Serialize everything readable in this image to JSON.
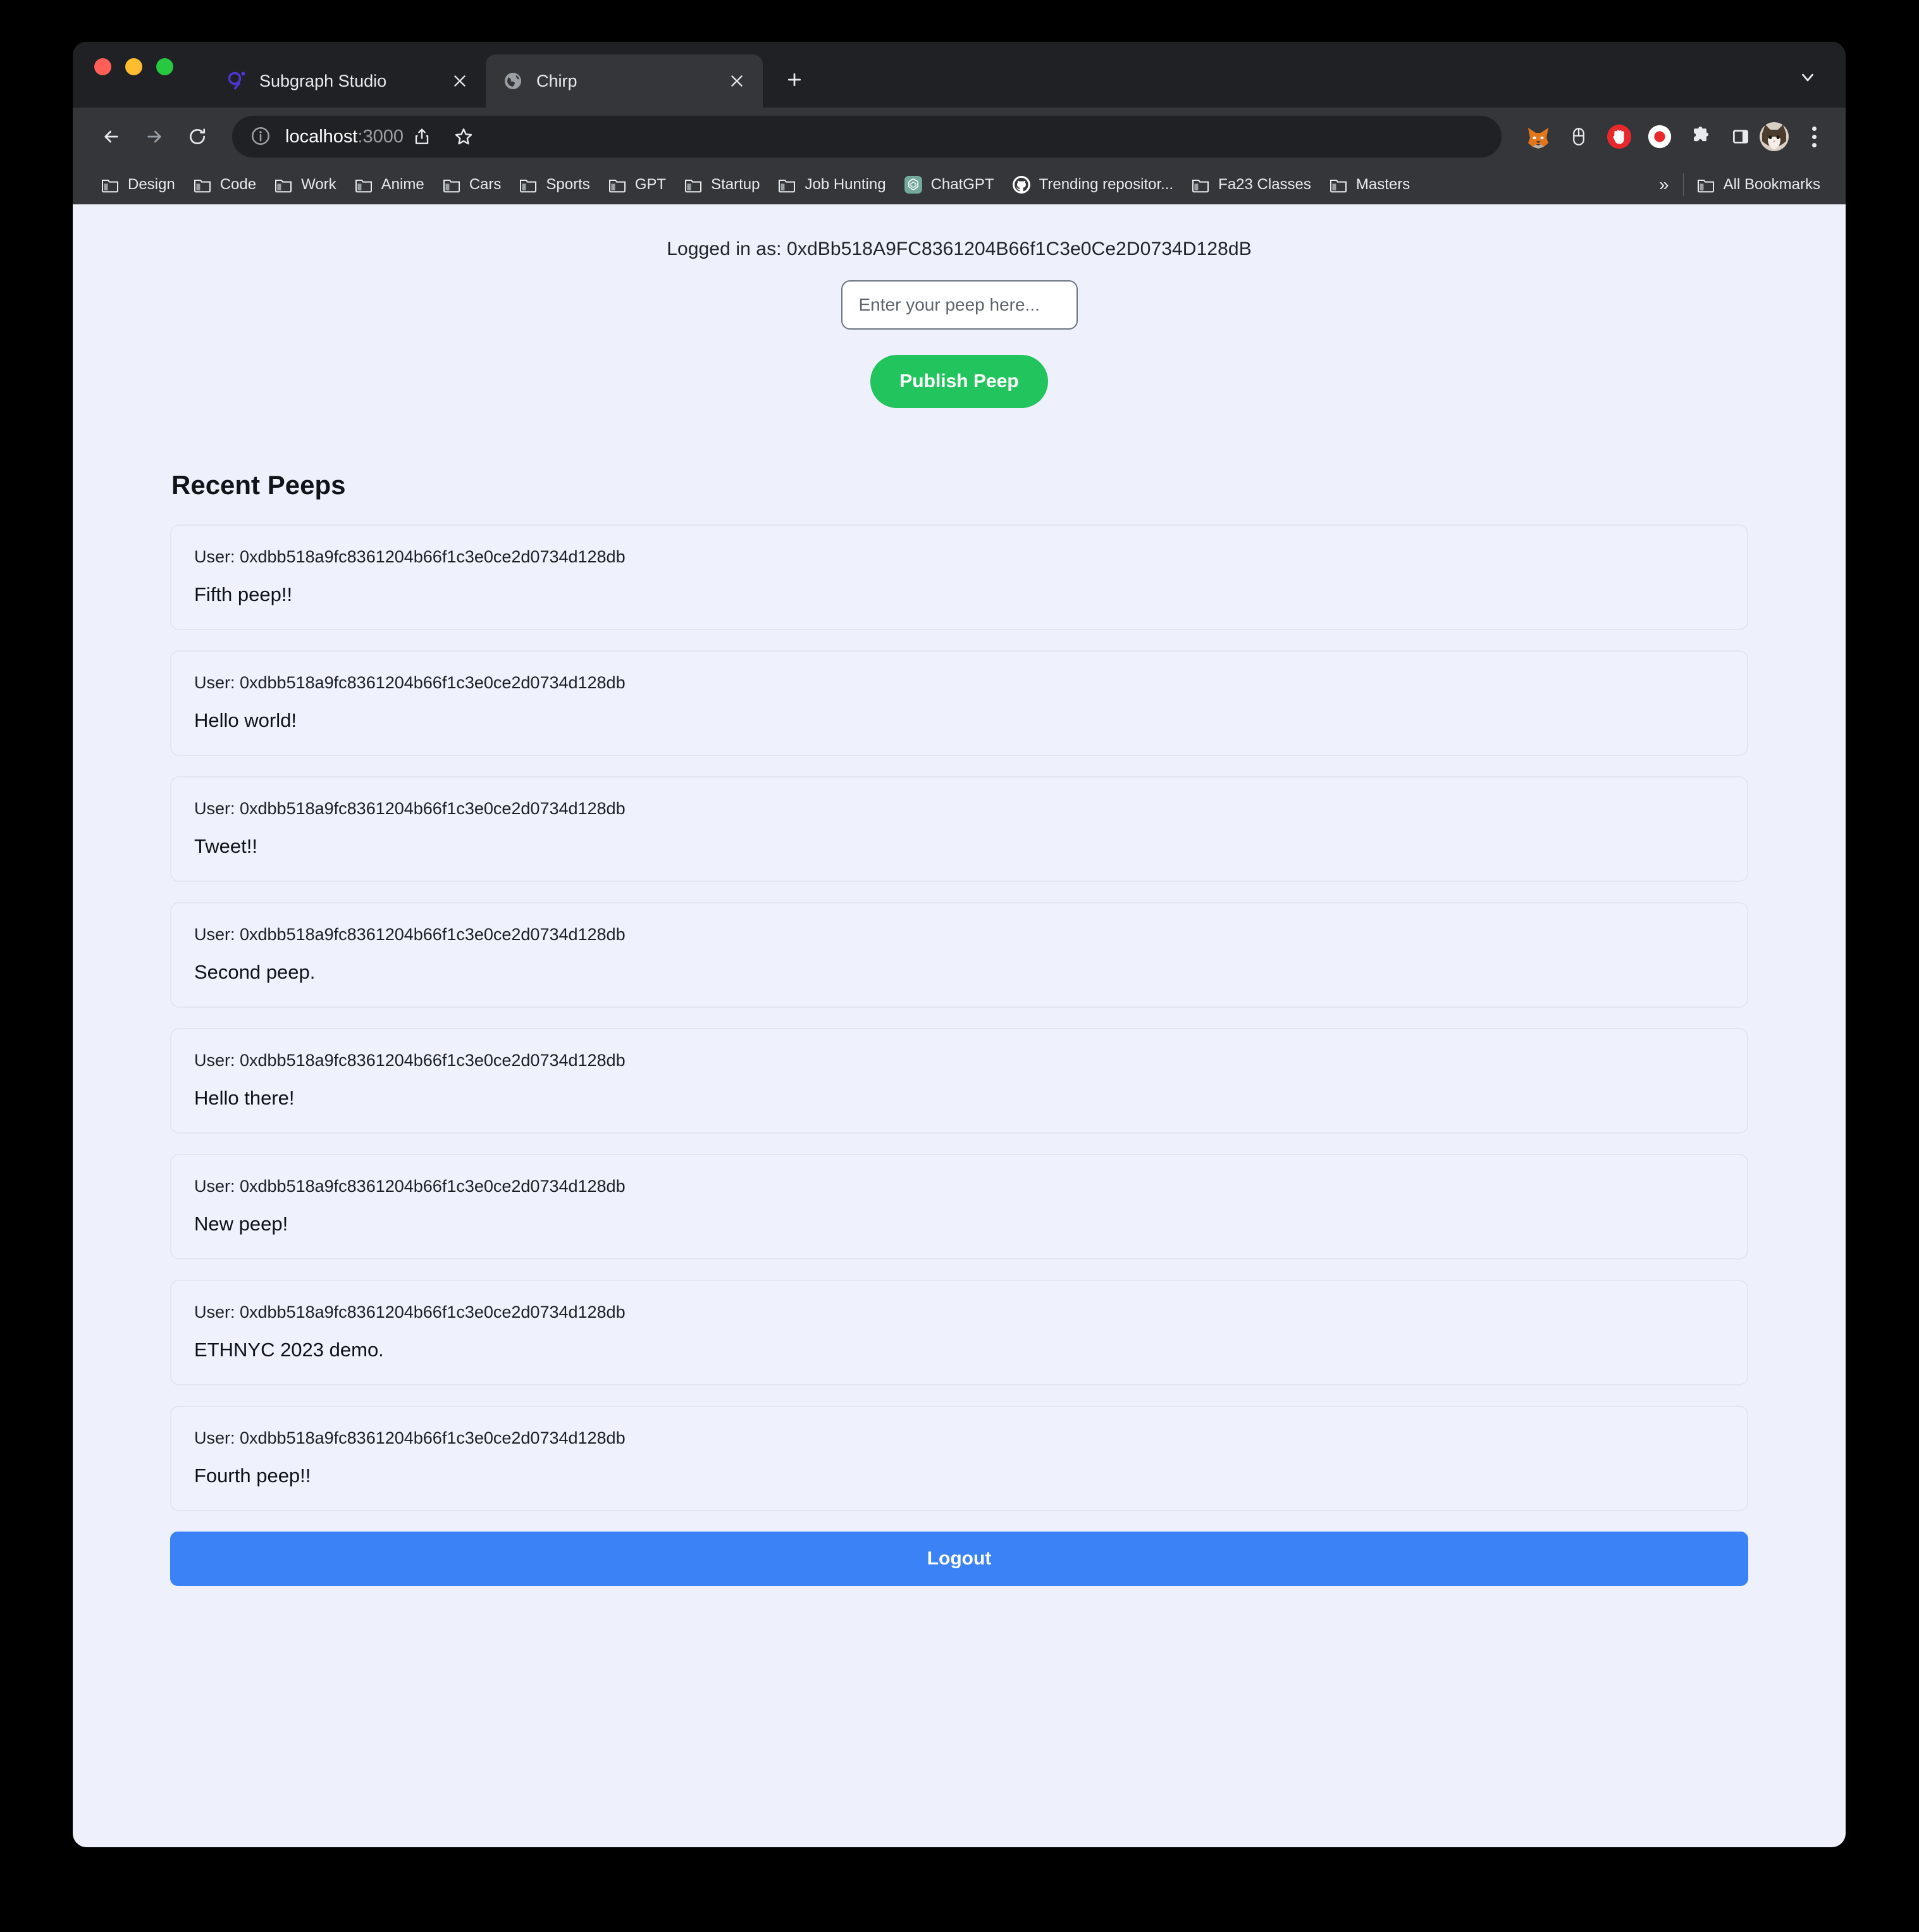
{
  "browser": {
    "window_controls": [
      "close",
      "minimize",
      "maximize"
    ],
    "tabs": [
      {
        "title": "Subgraph Studio",
        "favicon": "graph-logo-icon",
        "active": false,
        "close_label": "×"
      },
      {
        "title": "Chirp",
        "favicon": "globe-icon",
        "active": true,
        "close_label": "×"
      }
    ],
    "new_tab_label": "+",
    "tab_search_label": "⌄",
    "toolbar": {
      "back_label": "←",
      "forward_label": "→",
      "reload_label": "⟳",
      "site_info_icon": "info-circle-icon",
      "url_host": "localhost",
      "url_port": ":3000",
      "share_icon": "share-icon",
      "bookmark_icon": "star-icon",
      "extensions": [
        "metamask-fox-icon",
        "mouse-icon",
        "adblock-hand-icon",
        "record-dot-icon",
        "puzzle-piece-icon",
        "side-panel-icon"
      ],
      "profile_avatar": "cat-avatar",
      "menu_icon": "three-dot-menu-icon"
    },
    "bookmarks": [
      {
        "label": "Design",
        "icon": "folder-icon"
      },
      {
        "label": "Code",
        "icon": "folder-icon"
      },
      {
        "label": "Work",
        "icon": "folder-icon"
      },
      {
        "label": "Anime",
        "icon": "folder-icon"
      },
      {
        "label": "Cars",
        "icon": "folder-icon"
      },
      {
        "label": "Sports",
        "icon": "folder-icon"
      },
      {
        "label": "GPT",
        "icon": "folder-icon"
      },
      {
        "label": "Startup",
        "icon": "folder-icon"
      },
      {
        "label": "Job Hunting",
        "icon": "folder-icon"
      },
      {
        "label": "ChatGPT",
        "icon": "chatgpt-icon"
      },
      {
        "label": "Trending repositor...",
        "icon": "github-icon"
      },
      {
        "label": "Fa23 Classes",
        "icon": "folder-icon"
      },
      {
        "label": "Masters",
        "icon": "folder-icon"
      }
    ],
    "bookmarks_overflow_label": "»",
    "all_bookmarks_label": "All Bookmarks",
    "all_bookmarks_icon": "folder-icon"
  },
  "app": {
    "logged_in_as": "Logged in as: 0xdBb518A9FC8361204B66f1C3e0Ce2D0734D128dB",
    "compose": {
      "input_value": "",
      "input_placeholder": "Enter your peep here...",
      "publish_label": "Publish Peep"
    },
    "feed": {
      "title": "Recent Peeps",
      "user_prefix": "User: ",
      "peeps": [
        {
          "user": "User: 0xdbb518a9fc8361204b66f1c3e0ce2d0734d128db",
          "content": "Fifth peep!!"
        },
        {
          "user": "User: 0xdbb518a9fc8361204b66f1c3e0ce2d0734d128db",
          "content": "Hello world!"
        },
        {
          "user": "User: 0xdbb518a9fc8361204b66f1c3e0ce2d0734d128db",
          "content": "Tweet!!"
        },
        {
          "user": "User: 0xdbb518a9fc8361204b66f1c3e0ce2d0734d128db",
          "content": "Second peep."
        },
        {
          "user": "User: 0xdbb518a9fc8361204b66f1c3e0ce2d0734d128db",
          "content": "Hello there!"
        },
        {
          "user": "User: 0xdbb518a9fc8361204b66f1c3e0ce2d0734d128db",
          "content": "New peep!"
        },
        {
          "user": "User: 0xdbb518a9fc8361204b66f1c3e0ce2d0734d128db",
          "content": "ETHNYC 2023 demo."
        },
        {
          "user": "User: 0xdbb518a9fc8361204b66f1c3e0ce2d0734d128db",
          "content": "Fourth peep!!"
        }
      ]
    },
    "logout_label": "Logout"
  },
  "colors": {
    "page_background": "#eef0fb",
    "publish_green": "#21c45d",
    "logout_blue": "#3b82f6",
    "browser_chrome": "#35363a",
    "tab_strip": "#202124",
    "active_tab": "#35363a"
  }
}
